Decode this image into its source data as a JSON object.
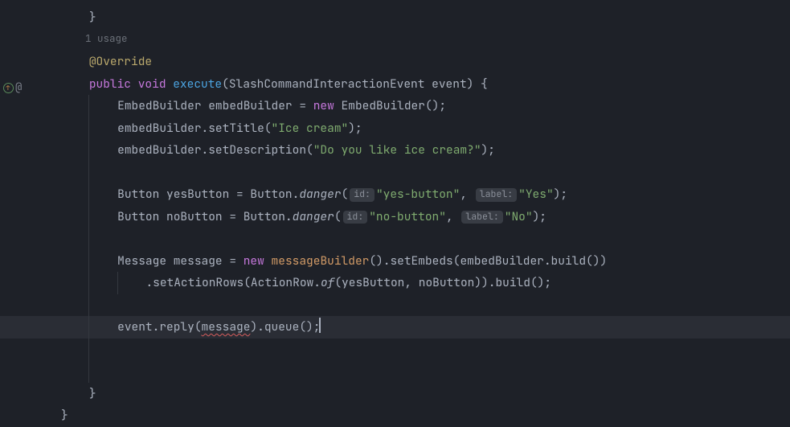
{
  "gutter": {
    "override_icon": "override-marker",
    "at_icon": "@"
  },
  "hints": {
    "usage": "1 usage",
    "id": "id:",
    "label": "label:"
  },
  "code": {
    "closing_brace_top": "}",
    "annotation": "@Override",
    "kw_public": "public",
    "kw_void": "void",
    "method_name": "execute",
    "param_type": "SlashCommandInteractionEvent",
    "param_name": "event",
    "line_decl_open": ") {",
    "l1_a": "EmbedBuilder embedBuilder = ",
    "l1_new": "new",
    "l1_b": " EmbedBuilder();",
    "l2_a": "embedBuilder.setTitle(",
    "l2_s": "\"Ice cream\"",
    "l2_b": ");",
    "l3_a": "embedBuilder.setDescription(",
    "l3_s": "\"Do you like ice cream?\"",
    "l3_b": ");",
    "l4_a": "Button yesButton = Button.",
    "l4_m": "danger",
    "l4_p1": "(",
    "l4_s1": "\"yes-button\"",
    "l4_c": ", ",
    "l4_s2": "\"Yes\"",
    "l4_p2": ");",
    "l5_a": "Button noButton = Button.",
    "l5_m": "danger",
    "l5_p1": "(",
    "l5_s1": "\"no-button\"",
    "l5_c": ", ",
    "l5_s2": "\"No\"",
    "l5_p2": ");",
    "l6_a": "Message message = ",
    "l6_new": "new",
    "l6_sp": " ",
    "l6_ctor": "messageBuilder",
    "l6_b": "().setEmbeds(embedBuilder.build())",
    "l7_a": ".setActionRows(ActionRow.",
    "l7_m": "of",
    "l7_b": "(yesButton, noButton)).build();",
    "l8_a": "event.reply(",
    "l8_err": "message",
    "l8_b": ").queue();",
    "brace_method": "}",
    "brace_class": "}"
  }
}
